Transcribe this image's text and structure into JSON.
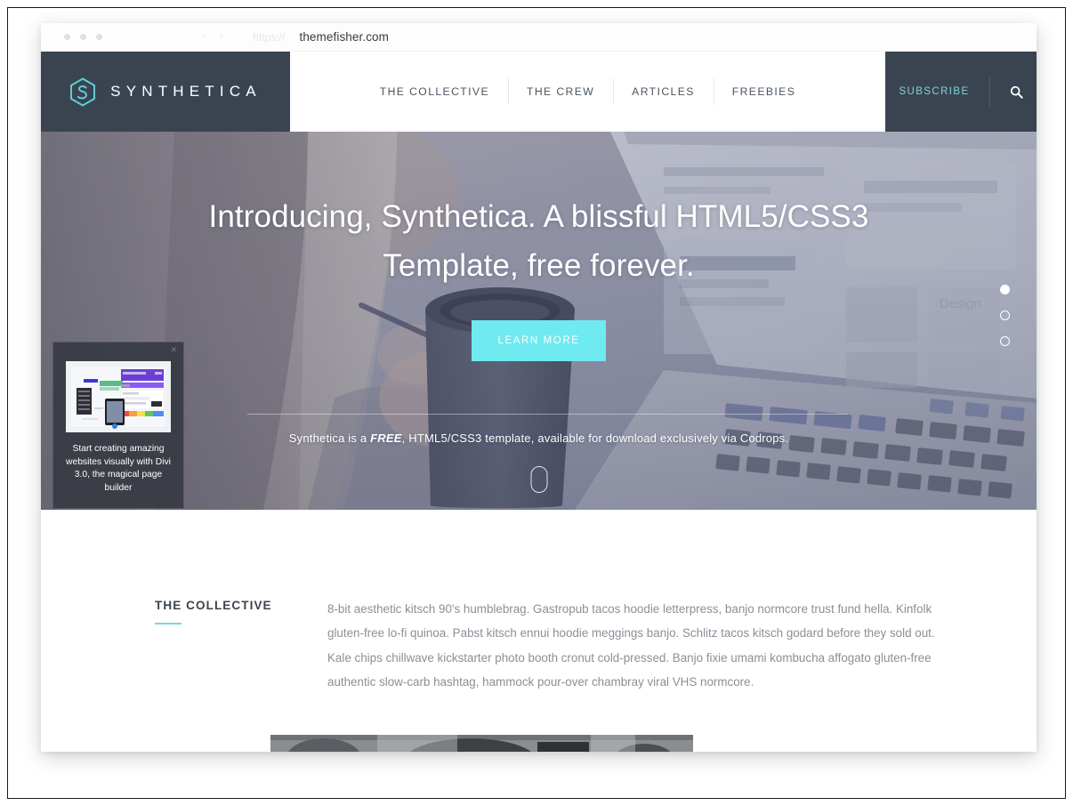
{
  "browser": {
    "url_scheme": "https://",
    "url_host": "themefisher.com",
    "back_arrow": "‹",
    "forward_arrow": "›"
  },
  "header": {
    "logo_text": "SYNTHETICA",
    "logo_icon": "hexagon-s-icon",
    "nav": [
      {
        "label": "THE COLLECTIVE"
      },
      {
        "label": "THE CREW"
      },
      {
        "label": "ARTICLES"
      },
      {
        "label": "FREEBIES"
      }
    ],
    "subscribe_label": "SUBSCRIBE",
    "search_icon": "search-icon",
    "accent_color": "#5fd8dd",
    "bar_color": "#3a4450"
  },
  "hero": {
    "title": "Introducing, Synthetica. A blissful HTML5/CSS3 Template, free forever.",
    "button_label": "LEARN MORE",
    "button_color": "#6feaf0",
    "subtitle_pre": "Synthetica is a ",
    "subtitle_strong": "FREE",
    "subtitle_post": ", HTML5/CSS3 template, available for download exclusively via Codrops.",
    "scroll_indicator": "mouse-scroll-icon",
    "carousel": {
      "count": 3,
      "active_index": 0
    }
  },
  "ad": {
    "close_label": "✕",
    "caption": "Start creating amazing websites visually with Divi 3.0, the magical page builder",
    "thumb_icon": "divi-builder-screenshot"
  },
  "collective": {
    "heading": "THE COLLECTIVE",
    "body": "8-bit aesthetic kitsch 90's humblebrag. Gastropub tacos hoodie letterpress, banjo normcore trust fund hella. Kinfolk gluten-free lo-fi quinoa. Pabst kitsch ennui hoodie meggings banjo. Schlitz tacos kitsch godard before they sold out. Kale chips chillwave kickstarter photo booth cronut cold-pressed. Banjo fixie umami kombucha affogato gluten-free authentic slow-carb hashtag, hammock pour-over chambray viral VHS normcore.",
    "rule_color": "#7fd4da"
  }
}
